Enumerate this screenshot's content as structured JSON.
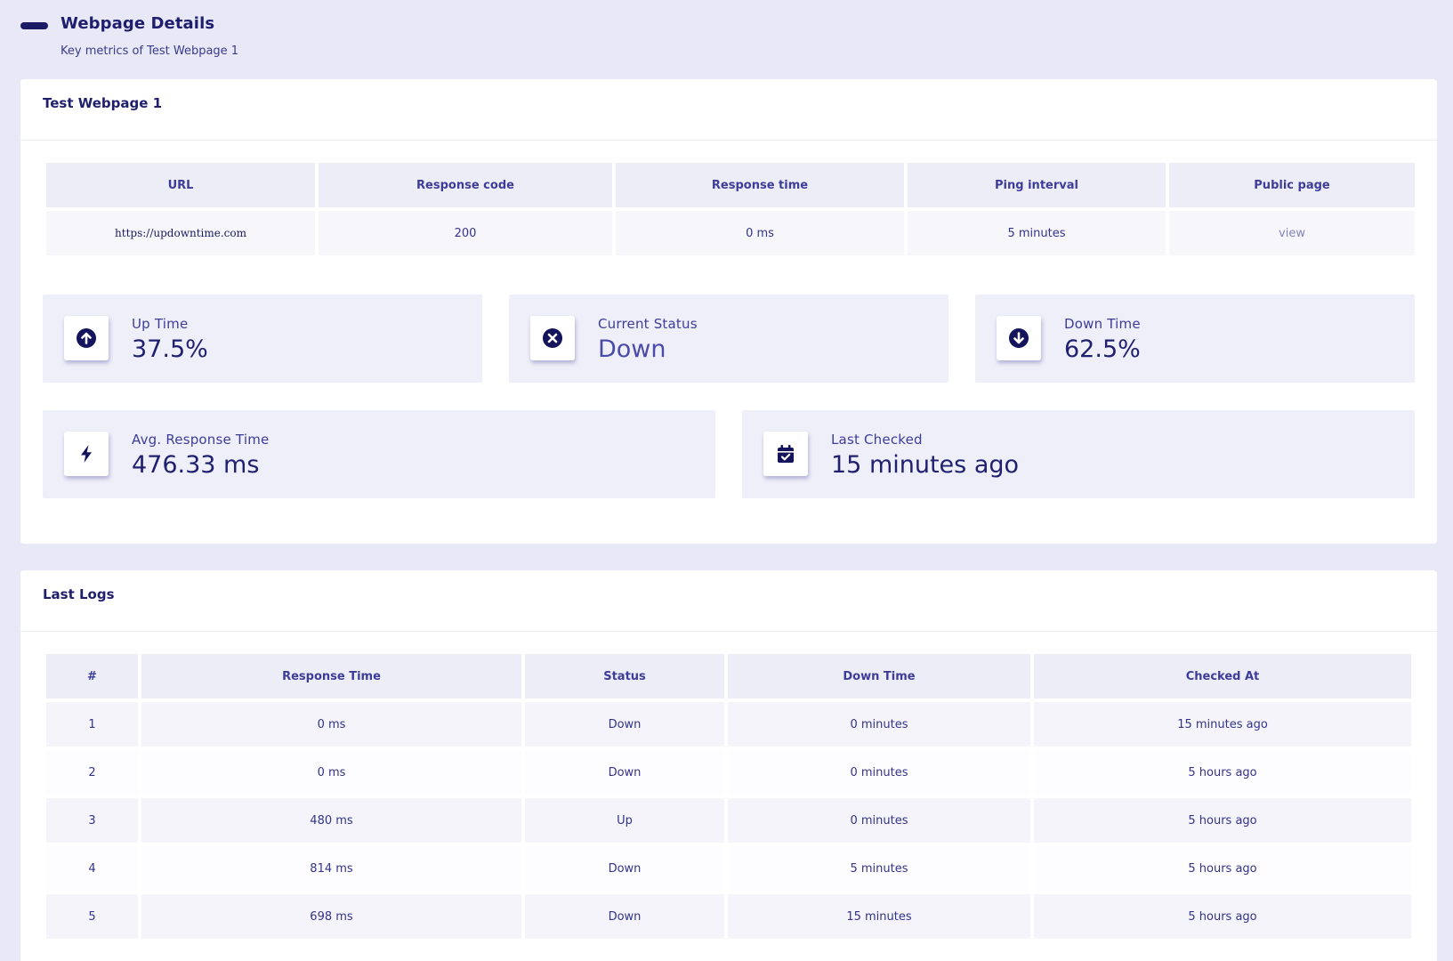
{
  "header": {
    "title": "Webpage Details",
    "subtitle": "Key metrics of Test Webpage 1"
  },
  "details": {
    "title": "Test Webpage 1",
    "columns": [
      "URL",
      "Response code",
      "Response time",
      "Ping interval",
      "Public page"
    ],
    "row": {
      "url": "https://updowntime.com",
      "response_code": "200",
      "response_time": "0 ms",
      "ping_interval": "5 minutes",
      "public_page": "view"
    }
  },
  "stats": {
    "uptime": {
      "label": "Up Time",
      "value": "37.5%",
      "icon": "arrow-up-circle-icon"
    },
    "status": {
      "label": "Current Status",
      "value": "Down",
      "icon": "x-circle-icon"
    },
    "downtime": {
      "label": "Down Time",
      "value": "62.5%",
      "icon": "arrow-down-circle-icon"
    },
    "avg_response": {
      "label": "Avg. Response Time",
      "value": "476.33 ms",
      "icon": "lightning-bolt-icon"
    },
    "last_checked": {
      "label": "Last Checked",
      "value": "15 minutes ago",
      "icon": "calendar-check-icon"
    }
  },
  "logs": {
    "title": "Last Logs",
    "columns": [
      "#",
      "Response Time",
      "Status",
      "Down Time",
      "Checked At"
    ],
    "rows": [
      [
        "1",
        "0 ms",
        "Down",
        "0 minutes",
        "15 minutes ago"
      ],
      [
        "2",
        "0 ms",
        "Down",
        "0 minutes",
        "5 hours ago"
      ],
      [
        "3",
        "480 ms",
        "Up",
        "0 minutes",
        "5 hours ago"
      ],
      [
        "4",
        "814 ms",
        "Down",
        "5 minutes",
        "5 hours ago"
      ],
      [
        "5",
        "698 ms",
        "Down",
        "15 minutes",
        "5 hours ago"
      ]
    ]
  },
  "colors": {
    "background": "#e9e8f6",
    "accent": "#1a1a66",
    "card": "#ffffff",
    "stat_background": "#efeff9"
  }
}
